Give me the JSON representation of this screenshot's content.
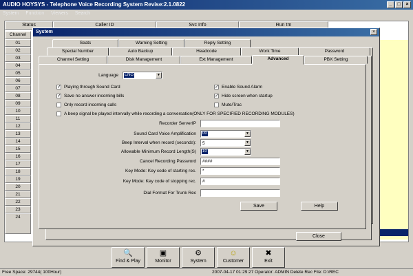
{
  "app": {
    "title": "AUDIO HOYSYS - Telephone Voice Recording System Revise:2.1.0822",
    "menu": [
      "System",
      "Function",
      "Viewers",
      "Search"
    ],
    "win_min": "_",
    "win_max": "□",
    "win_close": "×"
  },
  "table": {
    "headers": [
      "Status",
      "Caller ID",
      "Svc Info",
      "Run tm"
    ],
    "corner_label": "Channel",
    "rows": [
      "01",
      "02",
      "03",
      "04",
      "05",
      "06",
      "07",
      "08",
      "09",
      "10",
      "11",
      "12",
      "13",
      "14",
      "15",
      "16",
      "17",
      "18",
      "19",
      "20",
      "21",
      "22",
      "23",
      "24"
    ]
  },
  "toolbar": [
    {
      "label": "Find & Play",
      "icon": "🔍"
    },
    {
      "label": "Monitor",
      "icon": "▣"
    },
    {
      "label": "System",
      "icon": "⚙"
    },
    {
      "label": "Customer",
      "icon": "☺"
    },
    {
      "label": "Exit",
      "icon": "✖"
    }
  ],
  "status": {
    "left": "Free Space: 29744( 100Hour)",
    "right": "2007-04-17 01:29:27     Operator: ADMIN Delete Rec  File: D:\\REC"
  },
  "dialog": {
    "title": "System",
    "close": "×",
    "tabs_row1": [
      "Seats",
      "Warning Setting",
      "Reply Setting"
    ],
    "tabs_row2": [
      "Special Number",
      "Auto Backup",
      "Headcode",
      "Work Time",
      "Password"
    ],
    "tabs_row3": [
      "Channel Setting",
      "Disk Management",
      "Ext Management",
      "Advanced",
      "PBX Setting"
    ],
    "active_tab": "Advanced",
    "language_label": "Language",
    "language_value": "ENG",
    "checks_left": [
      {
        "label": "Playing through Sound Card",
        "checked": true
      },
      {
        "label": "Save no answer incoming bills",
        "checked": true
      },
      {
        "label": "Only record incoming calls",
        "checked": false
      }
    ],
    "checks_right": [
      {
        "label": "Enable Sound Alarm",
        "checked": true
      },
      {
        "label": "Hide screen when startup",
        "checked": true
      },
      {
        "label": "Mute/Trac",
        "checked": false
      }
    ],
    "beep_check": {
      "label": "A beep signal be played intervally while recording a conversation(ONLY FOR SPECIFIED RECORDING MODULES)",
      "checked": false
    },
    "fields": [
      {
        "label": "Recorder ServerIP",
        "value": "",
        "type": "text"
      },
      {
        "label": "Sound Card Voice Amplification",
        "value": "00",
        "type": "combo"
      },
      {
        "label": "Beep Interval when record (seconds):",
        "value": "5",
        "type": "combo"
      },
      {
        "label": "Allowable Minimum Record Length(S)",
        "value": "10",
        "type": "combo"
      },
      {
        "label": "Cancel Recording Password",
        "value": "####",
        "type": "text"
      },
      {
        "label": "Key Mode: Key code of starting rec.",
        "value": "*",
        "type": "text"
      },
      {
        "label": "Key Mode: Key code of stopping rec.",
        "value": "#",
        "type": "text"
      },
      {
        "label": "Dial Format For Trunk Rec",
        "value": "",
        "type": "text"
      }
    ],
    "save_label": "Save",
    "help_label": "Help",
    "close_label": "Close"
  }
}
